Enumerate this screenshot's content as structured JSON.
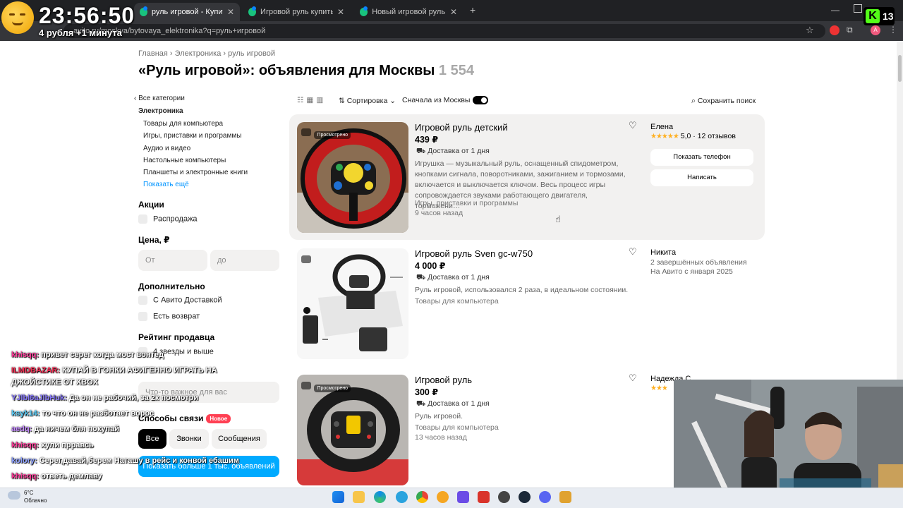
{
  "overlay": {
    "clock": "23:56:50",
    "clock_sub": "4 рубля +1 минута",
    "kick_count": "13",
    "kick_letter": "K"
  },
  "browser": {
    "tabs": [
      {
        "label": "руль игровой - Купить недорого"
      },
      {
        "label": "Игровой руль купить в Москве"
      },
      {
        "label": "Новый игровой руль с педалями"
      }
    ],
    "url": "avito.ru/moskva/bytovaya_elektronika?q=руль+игровой",
    "new_tab": "+"
  },
  "breadcrumb": [
    "Главная",
    "Электроника",
    "руль игровой"
  ],
  "page_title": "«Руль игровой»: объявления для Москвы",
  "result_count": "1 554",
  "sidebar": {
    "all_categories": "Все категории",
    "category": "Электроника",
    "subcategories": [
      "Товары для компьютера",
      "Игры, приставки и программы",
      "Аудио и видео",
      "Настольные компьютеры",
      "Планшеты и электронные книги"
    ],
    "show_more": "Показать ещё",
    "promo_head": "Акции",
    "promo_sale": "Распродажа",
    "price_head": "Цена, ₽",
    "price_from": "От",
    "price_to": "до",
    "extra_head": "Дополнительно",
    "extra_delivery": "С Авито Доставкой",
    "extra_return": "Есть возврат",
    "rating_head": "Рейтинг продавца",
    "rating_4": "4 звезды и выше",
    "important_placeholder": "Что-то важное для вас",
    "contact_head": "Способы связи",
    "new_badge": "Новое",
    "contact_all": "Все",
    "contact_calls": "Звонки",
    "contact_msgs": "Сообщения",
    "show_button": "Показать больше 1 тыс. объявлений"
  },
  "toolbar": {
    "sort": "Сортировка",
    "moscow_first": "Сначала из Москвы",
    "save_search": "Сохранить поиск"
  },
  "listings": [
    {
      "title": "Игровой руль детский",
      "price": "439 ₽",
      "delivery": "Доставка от 1 дня",
      "desc": "Игрушка — музыкальный руль, оснащенный спидометром, кнопками сигнала, поворотниками, зажиганием и тормозами, включается и выключается ключом. Весь процесс игры сопровождается звуками работающего двигателя, торможени…",
      "category": "Игры, приставки и программы",
      "time": "9 часов назад",
      "seen": "Просмотрено",
      "seller": "Елена",
      "rating": "5,0 · 12 отзывов",
      "show_phone": "Показать телефон",
      "write": "Написать"
    },
    {
      "title": "Игровой руль Sven gc-w750",
      "price": "4 000 ₽",
      "delivery": "Доставка от 1 дня",
      "desc": "Руль игровой, использовался 2 раза, в идеальном состоянии.",
      "category": "Товары для компьютера",
      "seller": "Никита",
      "seller_line1": "2 завершённых объявления",
      "seller_line2": "На Авито с января 2025"
    },
    {
      "title": "Игровой руль",
      "price": "300 ₽",
      "delivery": "Доставка от 1 дня",
      "desc": "Руль игровой.",
      "category": "Товары для компьютера",
      "time": "13 часов назад",
      "seen": "Просмотрено",
      "seller": "Надежда С."
    }
  ],
  "chat": [
    {
      "name": "khisqq:",
      "text": "привет серег когда мост вонтед",
      "color": "#ff3b9a"
    },
    {
      "name": "ILMDBAZAR:",
      "text": "КУПАЙ В ГОНКИ АФИГЕННО ИГРАТЬ НА",
      "color": "#ff2d55"
    },
    {
      "name": "",
      "text": "ДЖОЙСТИКЕ ОТ XBOX",
      "color": "#ffffff"
    },
    {
      "name": "YJlbl6aJlbHuk:",
      "text": "Да он не рабочий, за 2к посмотри",
      "color": "#8a7bff"
    },
    {
      "name": "ksyk14:",
      "text": "то что он не разботает ворос",
      "color": "#5fd3ff"
    },
    {
      "name": "aedq:",
      "text": "да ничем бля покупай",
      "color": "#c58cff"
    },
    {
      "name": "khisqq:",
      "text": "хули прравсь",
      "color": "#ff3b9a"
    },
    {
      "name": "kolory:",
      "text": "Серег,давай,берем Наташу в рейс и конвой ебашим",
      "color": "#8fa2ff"
    },
    {
      "name": "khisqq:",
      "text": "ответь демлаву",
      "color": "#ff3b9a"
    }
  ],
  "taskbar": {
    "temp": "6°C",
    "weather": "Облачно"
  },
  "colors": {
    "accent": "#00aaff",
    "badge_new": "#ff4053",
    "stars": "#ffb021"
  }
}
